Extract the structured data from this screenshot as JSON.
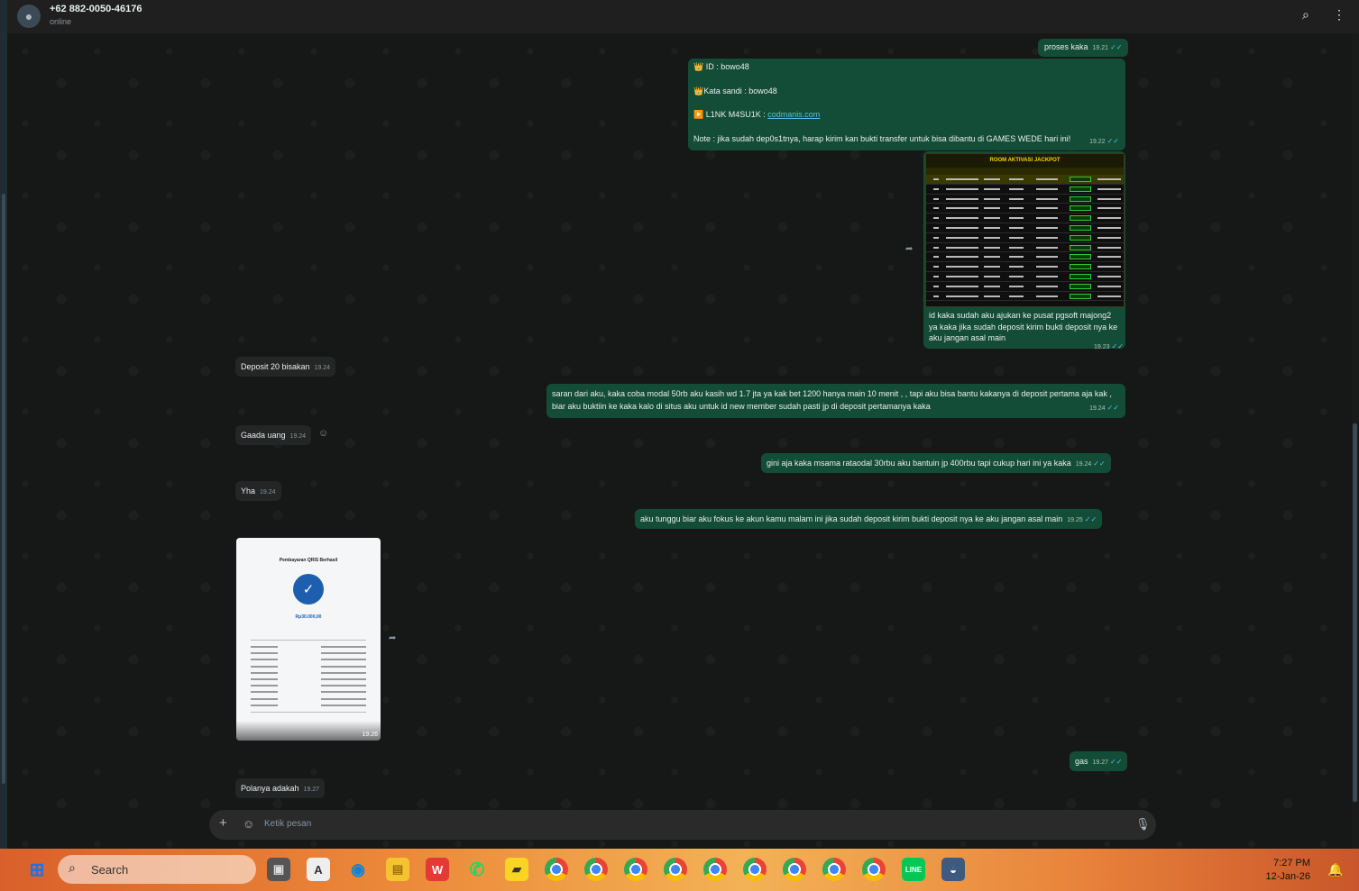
{
  "header": {
    "name": "+62 882-0050-46176",
    "status": "online"
  },
  "messages": {
    "m1": {
      "text": "proses kaka",
      "time": "19.21"
    },
    "m2": {
      "line1": "👑 ID :  bowo48",
      "line2": "👑Kata sandi : bowo48",
      "line3_prefix": "▶️ L1NK M4SU1K : ",
      "line3_link": "codmanis.com",
      "line4": "Note : jika sudah dep0s1tnya, harap kirim kan bukti transfer untuk bisa dibantu di GAMES WEDE hari ini!",
      "time": "19.22"
    },
    "m3": {
      "image_title": "ROOM AKTIVASI JACKPOT",
      "caption": "id kaka sudah aku ajukan ke pusat pgsoft majong2 ya kaka jika sudah deposit kirim bukti deposit nya ke aku jangan asal main",
      "time": "19.23"
    },
    "m4": {
      "text": "Deposit 20 bisakan",
      "time": "19.24"
    },
    "m5": {
      "text": "saran dari aku, kaka coba modal 50rb aku kasih wd 1.7 jta ya kak bet 1200 hanya main 10 menit , , tapi aku bisa bantu kakanya di deposit pertama aja kak , biar aku buktiin ke kaka kalo di situs aku untuk id new member sudah pasti jp di deposit pertamanya kaka",
      "time": "19.24"
    },
    "m6": {
      "text": "Gaada uang",
      "time": "19.24"
    },
    "m7": {
      "text": "gini aja kaka msama rataodal 30rbu aku bantuin jp 400rbu tapi cukup hari ini ya kaka",
      "time": "19.24"
    },
    "m8": {
      "text": "Yha",
      "time": "19.24"
    },
    "m9": {
      "text": "aku tunggu biar aku fokus ke akun kamu malam ini jika sudah deposit kirim bukti deposit nya ke aku jangan asal main",
      "time": "19.25"
    },
    "m10": {
      "title": "Pembayaran QRIS Berhasil",
      "amount": "Rp30.000,00",
      "time": "19.26"
    },
    "m11": {
      "text": "gas",
      "time": "19.27"
    },
    "m12": {
      "text": "Polanya adakah",
      "time": "19.27"
    }
  },
  "input": {
    "placeholder": "Ketik pesan"
  },
  "taskbar": {
    "search_label": "Search",
    "time": "7:27 PM",
    "date": "12-Jan-26"
  }
}
